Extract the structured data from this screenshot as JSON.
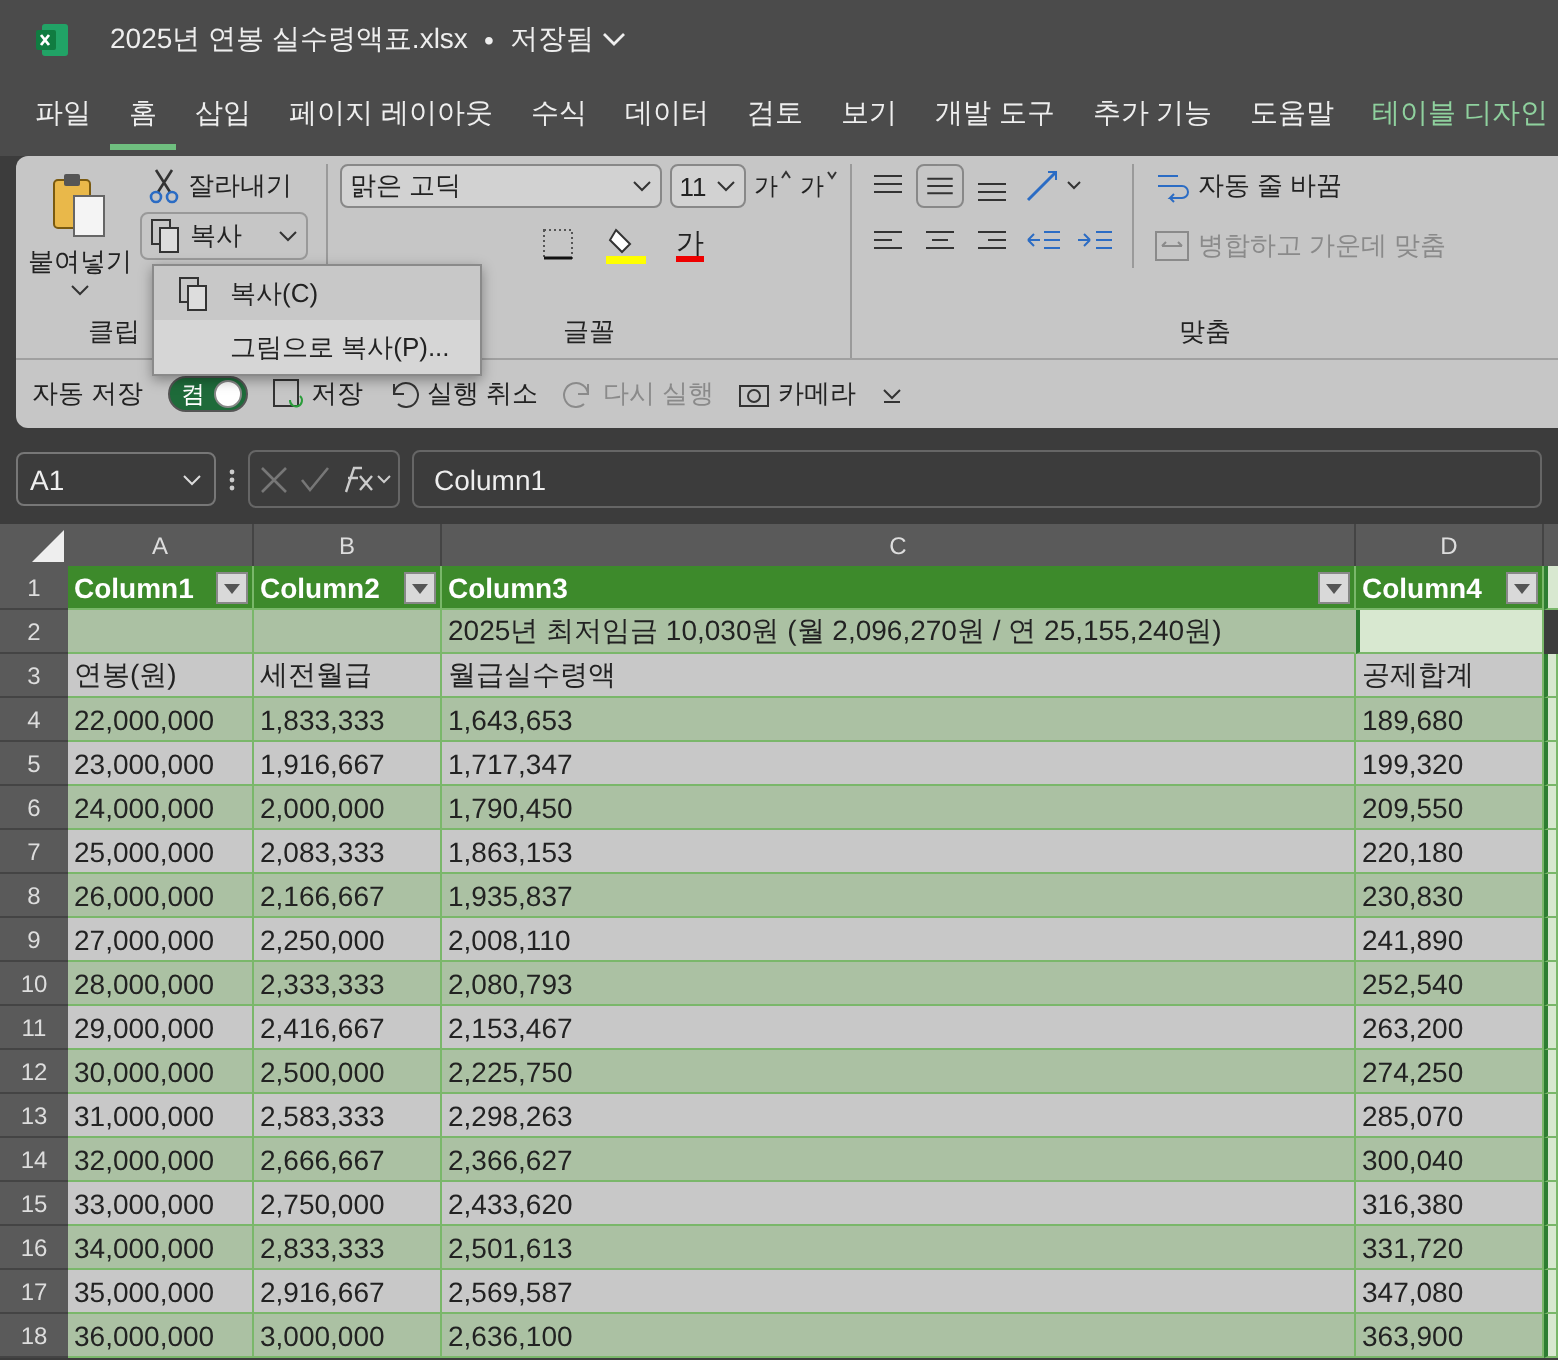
{
  "title_bar": {
    "filename": "2025년 연봉 실수령액표.xlsx",
    "separator": "•",
    "save_status": "저장됨"
  },
  "menu_tabs": [
    {
      "label": "파일",
      "selected": false,
      "kind": "normal"
    },
    {
      "label": "홈",
      "selected": true,
      "kind": "normal"
    },
    {
      "label": "삽입",
      "selected": false,
      "kind": "normal"
    },
    {
      "label": "페이지 레이아웃",
      "selected": false,
      "kind": "normal"
    },
    {
      "label": "수식",
      "selected": false,
      "kind": "normal"
    },
    {
      "label": "데이터",
      "selected": false,
      "kind": "normal"
    },
    {
      "label": "검토",
      "selected": false,
      "kind": "normal"
    },
    {
      "label": "보기",
      "selected": false,
      "kind": "normal"
    },
    {
      "label": "개발 도구",
      "selected": false,
      "kind": "normal"
    },
    {
      "label": "추가 기능",
      "selected": false,
      "kind": "normal"
    },
    {
      "label": "도움말",
      "selected": false,
      "kind": "normal"
    },
    {
      "label": "테이블 디자인",
      "selected": false,
      "kind": "contextual"
    }
  ],
  "ribbon": {
    "clipboard": {
      "paste": "붙여넣기",
      "cut": "잘라내기",
      "copy": "복사",
      "group_label": "클립"
    },
    "font": {
      "font_name": "맑은 고딕",
      "font_size": "11",
      "grow": "가",
      "shrink": "가",
      "font_color": "가",
      "group_label": "글꼴"
    },
    "alignment": {
      "wrap_text": "자동 줄 바꿈",
      "merge": {
        "label": "병합하고 가운데 맞춤",
        "disabled": true
      },
      "group_label": "맞춤"
    }
  },
  "copy_menu": [
    {
      "label": "복사(C)",
      "selected": false
    },
    {
      "label": "그림으로 복사(P)...",
      "selected": true
    }
  ],
  "quick_access": {
    "autosave": "자동 저장",
    "toggle": {
      "label": "켬",
      "on": true
    },
    "save": "저장",
    "undo": "실행 취소",
    "redo": {
      "label": "다시 실행",
      "disabled": true
    },
    "camera": "카메라"
  },
  "formula_bar": {
    "name_box": "A1",
    "formula": "Column1"
  },
  "sheet": {
    "columns": [
      "A",
      "B",
      "C",
      "D"
    ],
    "row_numbers": [
      "1",
      "2",
      "3",
      "4",
      "5",
      "6",
      "7",
      "8",
      "9",
      "10",
      "11",
      "12",
      "13",
      "14",
      "15",
      "16",
      "17",
      "18"
    ],
    "table_headers": [
      "Column1",
      "Column2",
      "Column3",
      "Column4"
    ],
    "title_row": "2025년 최저임금 10,030원 (월 2,096,270원 / 연 25,155,240원)",
    "label_row": [
      "연봉(원)",
      "세전월급",
      "월급실수령액",
      "공제합계"
    ],
    "rows": [
      [
        "22,000,000",
        "1,833,333",
        "1,643,653",
        "189,680"
      ],
      [
        "23,000,000",
        "1,916,667",
        "1,717,347",
        "199,320"
      ],
      [
        "24,000,000",
        "2,000,000",
        "1,790,450",
        "209,550"
      ],
      [
        "25,000,000",
        "2,083,333",
        "1,863,153",
        "220,180"
      ],
      [
        "26,000,000",
        "2,166,667",
        "1,935,837",
        "230,830"
      ],
      [
        "27,000,000",
        "2,250,000",
        "2,008,110",
        "241,890"
      ],
      [
        "28,000,000",
        "2,333,333",
        "2,080,793",
        "252,540"
      ],
      [
        "29,000,000",
        "2,416,667",
        "2,153,467",
        "263,200"
      ],
      [
        "30,000,000",
        "2,500,000",
        "2,225,750",
        "274,250"
      ],
      [
        "31,000,000",
        "2,583,333",
        "2,298,263",
        "285,070"
      ],
      [
        "32,000,000",
        "2,666,667",
        "2,366,627",
        "300,040"
      ],
      [
        "33,000,000",
        "2,750,000",
        "2,433,620",
        "316,380"
      ],
      [
        "34,000,000",
        "2,833,333",
        "2,501,613",
        "331,720"
      ],
      [
        "35,000,000",
        "2,916,667",
        "2,569,587",
        "347,080"
      ],
      [
        "36,000,000",
        "3,000,000",
        "2,636,100",
        "363,900"
      ]
    ]
  }
}
